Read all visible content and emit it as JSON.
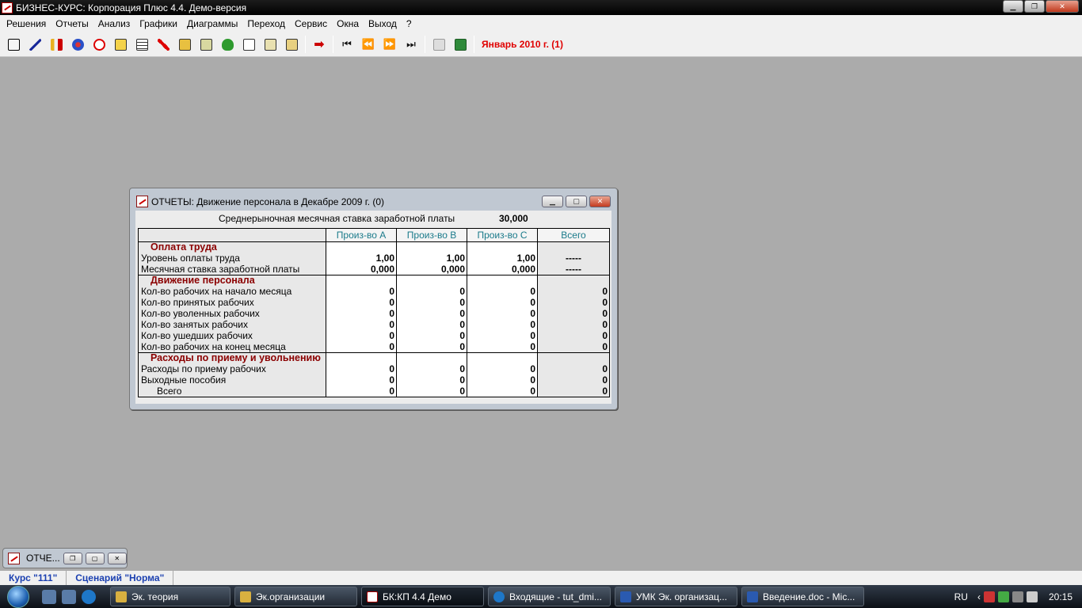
{
  "app": {
    "title": "БИЗНЕС-КУРС: Корпорация Плюс 4.4. Демо-версия"
  },
  "menu": [
    "Решения",
    "Отчеты",
    "Анализ",
    "Графики",
    "Диаграммы",
    "Переход",
    "Сервис",
    "Окна",
    "Выход",
    "?"
  ],
  "toolbar": {
    "tools_group1": [
      "decisions-icon",
      "chart-up-icon",
      "finance-icon",
      "people-icon",
      "warning-shape-icon",
      "book-icon",
      "table-icon",
      "chart-down-icon",
      "bank-icon",
      "bank2-icon",
      "money-bag-icon",
      "report-icon",
      "print-list-icon",
      "export-icon"
    ],
    "period": "Январь 2010 г. (1)"
  },
  "report_window": {
    "title": "ОТЧЕТЫ: Движение персонала в Декабре 2009 г. (0)",
    "rate_label": "Среднерыночная месячная ставка заработной платы",
    "rate_value": "30,000",
    "columns": [
      "Произ-во A",
      "Произ-во B",
      "Произ-во C",
      "Всего"
    ],
    "sections": [
      {
        "title": "Оплата труда",
        "rows": [
          {
            "name": "Уровень оплаты труда",
            "values": [
              "1,00",
              "1,00",
              "1,00",
              "-----"
            ]
          },
          {
            "name": "Месячная ставка заработной платы",
            "values": [
              "0,000",
              "0,000",
              "0,000",
              "-----"
            ]
          }
        ]
      },
      {
        "title": "Движение персонала",
        "rows": [
          {
            "name": "Кол-во рабочих на начало месяца",
            "values": [
              "0",
              "0",
              "0",
              "0"
            ]
          },
          {
            "name": "Кол-во принятых рабочих",
            "values": [
              "0",
              "0",
              "0",
              "0"
            ]
          },
          {
            "name": "Кол-во уволенных рабочих",
            "values": [
              "0",
              "0",
              "0",
              "0"
            ]
          },
          {
            "name": "Кол-во занятых рабочих",
            "values": [
              "0",
              "0",
              "0",
              "0"
            ]
          },
          {
            "name": "Кол-во ушедших рабочих",
            "values": [
              "0",
              "0",
              "0",
              "0"
            ]
          },
          {
            "name": "Кол-во рабочих на конец месяца",
            "values": [
              "0",
              "0",
              "0",
              "0"
            ]
          }
        ]
      },
      {
        "title": "Расходы по приему и увольнению",
        "rows": [
          {
            "name": "Расходы по приему рабочих",
            "values": [
              "0",
              "0",
              "0",
              "0"
            ]
          },
          {
            "name": "Выходные пособия",
            "values": [
              "0",
              "0",
              "0",
              "0"
            ]
          },
          {
            "name": "Всего",
            "values": [
              "0",
              "0",
              "0",
              "0"
            ]
          }
        ]
      }
    ]
  },
  "minimized_window": {
    "title": "ОТЧЕ..."
  },
  "statusbar": {
    "course": "Курс \"111\"",
    "scenario": "Сценарий \"Норма\""
  },
  "taskbar": {
    "tasks": [
      "Эк. теория",
      "Эк.организации",
      "БК:КП 4.4 Демо",
      "Входящие - tut_dmi...",
      "УМК Эк. организац...",
      "Введение.doc - Mic..."
    ],
    "lang": "RU",
    "clock": "20:15"
  }
}
